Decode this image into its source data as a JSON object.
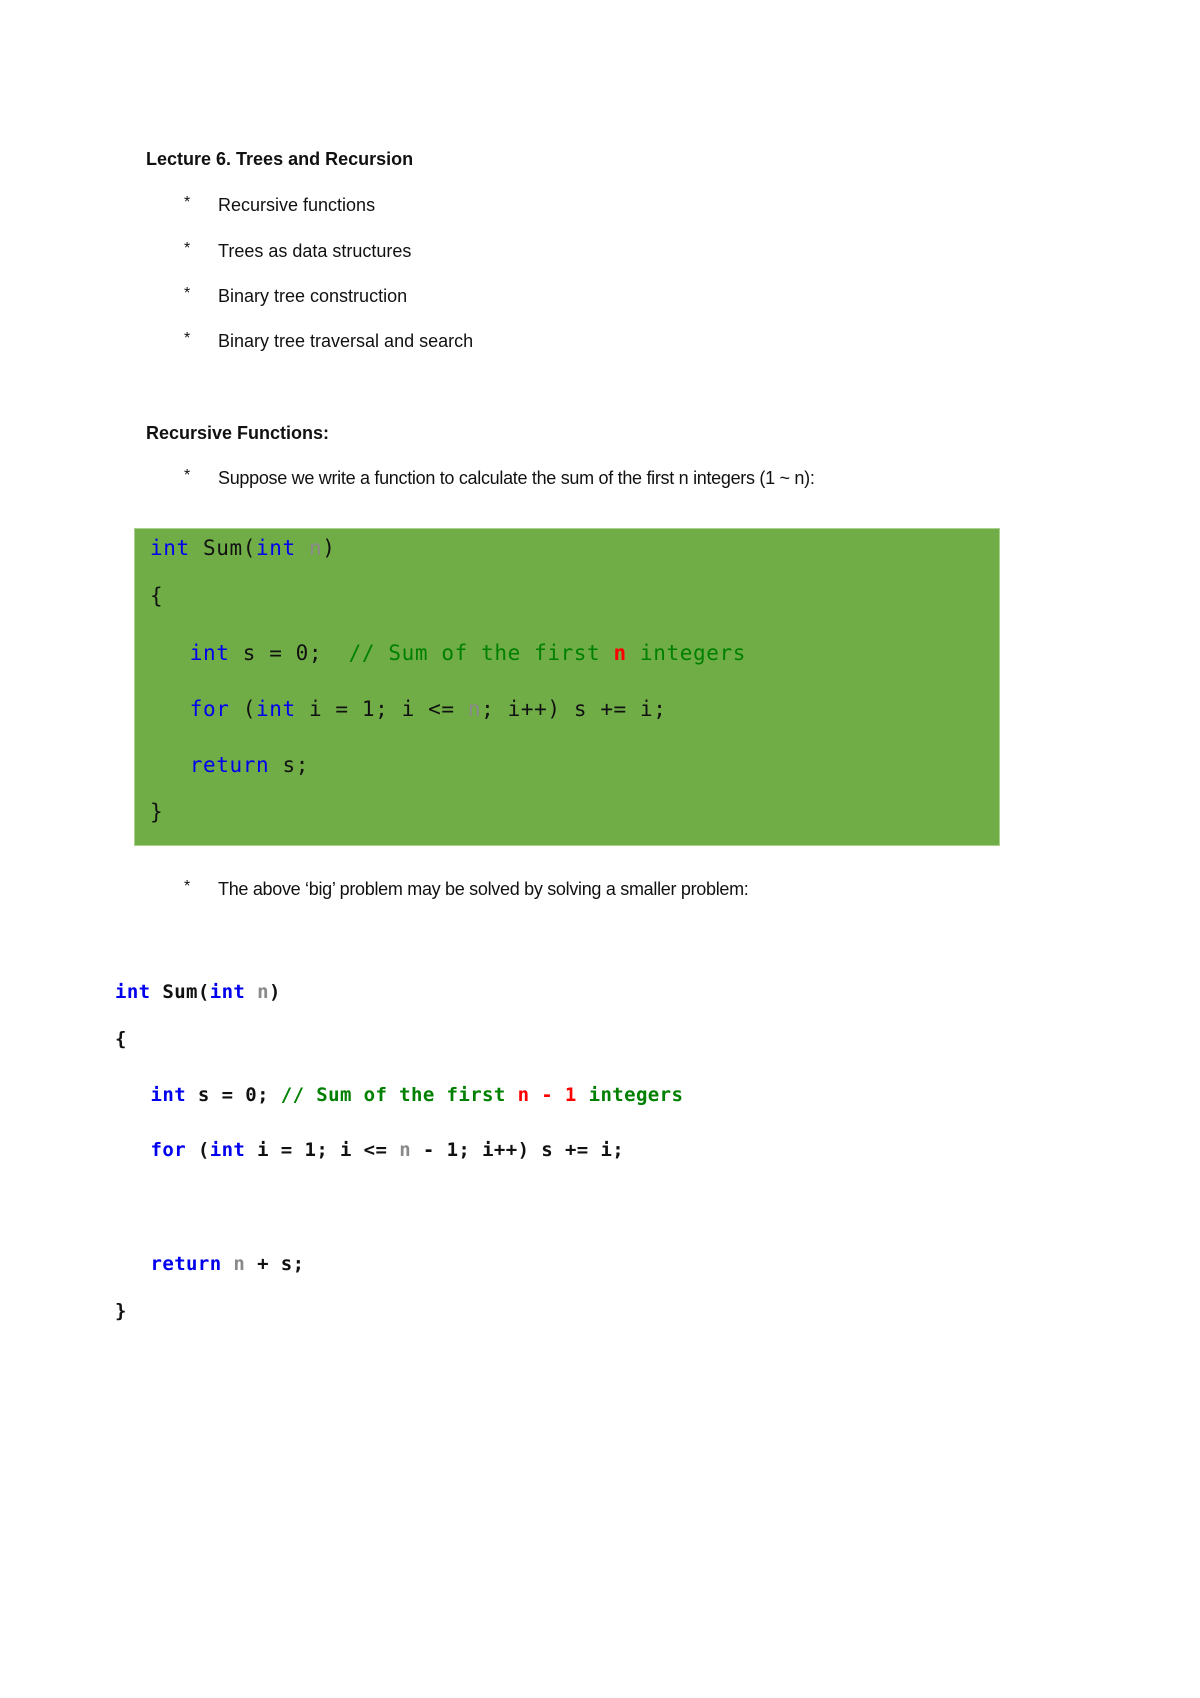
{
  "document": {
    "title": "Lecture 6. Trees and Recursion",
    "outline": [
      {
        "bullet": "*",
        "text": "Recursive functions"
      },
      {
        "bullet": "*",
        "text": "Trees as data structures"
      },
      {
        "bullet": "*",
        "text": "Binary tree construction"
      },
      {
        "bullet": "*",
        "text": "Binary tree traversal and search"
      }
    ],
    "section_heading": "Recursive Functions:",
    "section_points": [
      {
        "bullet": "*",
        "text": "Suppose we write a function to calculate the sum of the first n integers (1 ~ n):"
      },
      {
        "bullet": "*",
        "text": "The above ‘big’ problem may be solved by solving a smaller problem:"
      }
    ],
    "code_box_color": "#70ad47",
    "code_block_1": {
      "lines": [
        [
          {
            "t": "int",
            "c": "kw"
          },
          {
            "t": " Sum(",
            "c": "plain"
          },
          {
            "t": "int",
            "c": "kw"
          },
          {
            "t": " ",
            "c": "plain"
          },
          {
            "t": "n",
            "c": "param"
          },
          {
            "t": ")",
            "c": "plain"
          }
        ],
        [
          {
            "t": "{",
            "c": "plain"
          }
        ],
        [
          {
            "t": "   ",
            "c": "plain"
          },
          {
            "t": "int",
            "c": "kw"
          },
          {
            "t": " s = 0;  ",
            "c": "plain"
          },
          {
            "t": "// Sum of the first ",
            "c": "cm"
          },
          {
            "t": "n",
            "c": "hl"
          },
          {
            "t": " integers",
            "c": "cm"
          }
        ],
        [
          {
            "t": "   ",
            "c": "plain"
          },
          {
            "t": "for",
            "c": "kw"
          },
          {
            "t": " (",
            "c": "plain"
          },
          {
            "t": "int",
            "c": "kw"
          },
          {
            "t": " i = 1; i <= ",
            "c": "plain"
          },
          {
            "t": "n",
            "c": "param"
          },
          {
            "t": "; i++) s += i;",
            "c": "plain"
          }
        ],
        [
          {
            "t": "   ",
            "c": "plain"
          },
          {
            "t": "return",
            "c": "kw"
          },
          {
            "t": " s;",
            "c": "plain"
          }
        ],
        [
          {
            "t": "}",
            "c": "plain"
          }
        ]
      ]
    },
    "code_block_2": {
      "lines": [
        [
          {
            "t": "int",
            "c": "kw"
          },
          {
            "t": " Sum(",
            "c": "plain"
          },
          {
            "t": "int",
            "c": "kw"
          },
          {
            "t": " ",
            "c": "plain"
          },
          {
            "t": "n",
            "c": "param"
          },
          {
            "t": ")",
            "c": "plain"
          }
        ],
        [
          {
            "t": "{",
            "c": "plain"
          }
        ],
        [
          {
            "t": "   ",
            "c": "plain"
          },
          {
            "t": "int",
            "c": "kw"
          },
          {
            "t": " s = 0; ",
            "c": "plain"
          },
          {
            "t": "// Sum of the first ",
            "c": "cm"
          },
          {
            "t": "n - 1",
            "c": "hl"
          },
          {
            "t": " integers",
            "c": "cm"
          }
        ],
        [
          {
            "t": "   ",
            "c": "plain"
          },
          {
            "t": "for",
            "c": "kw"
          },
          {
            "t": " (",
            "c": "plain"
          },
          {
            "t": "int",
            "c": "kw"
          },
          {
            "t": " i = 1; i <= ",
            "c": "plain"
          },
          {
            "t": "n",
            "c": "param"
          },
          {
            "t": " - 1; i++) s += i;",
            "c": "plain"
          }
        ],
        [
          {
            "t": "",
            "c": "plain"
          }
        ],
        [
          {
            "t": "   ",
            "c": "plain"
          },
          {
            "t": "return",
            "c": "kw"
          },
          {
            "t": " ",
            "c": "plain"
          },
          {
            "t": "n",
            "c": "param"
          },
          {
            "t": " + s;",
            "c": "plain"
          }
        ],
        [
          {
            "t": "}",
            "c": "plain"
          }
        ]
      ]
    }
  }
}
